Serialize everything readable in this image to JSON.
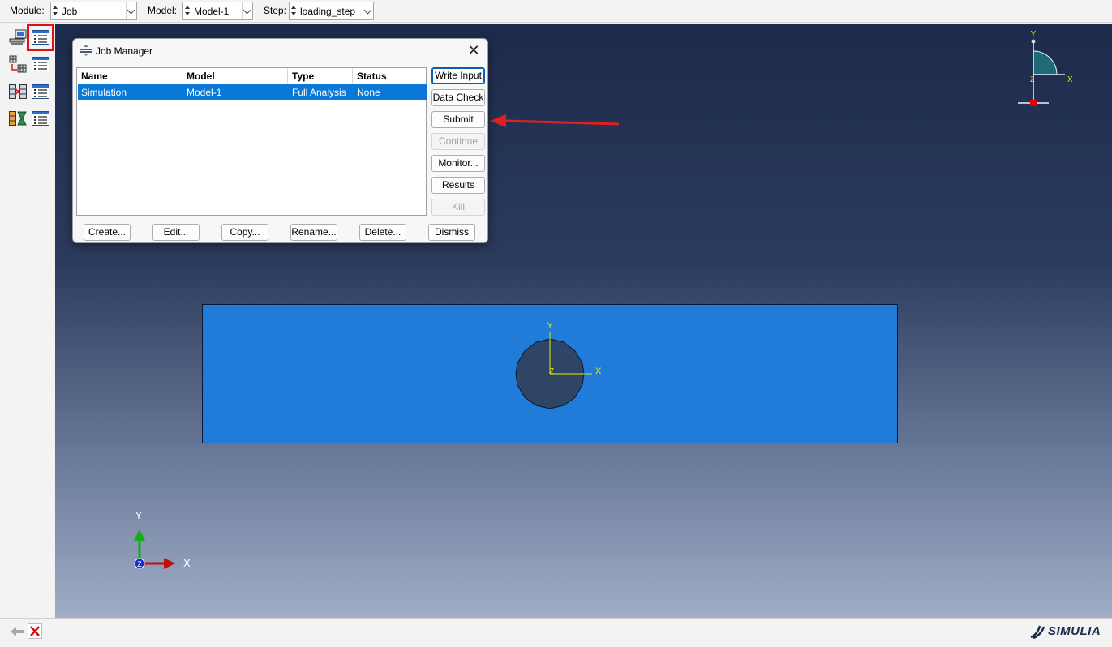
{
  "context_bar": {
    "module_label": "Module:",
    "module_value": "Job",
    "model_label": "Model:",
    "model_value": "Model-1",
    "step_label": "Step:",
    "step_value": "loading_step"
  },
  "toolbox": {
    "tools": [
      {
        "name": "job-create-icon",
        "highlighted": false
      },
      {
        "name": "job-manager-icon",
        "highlighted": true
      },
      {
        "name": "adaptivity-create-icon",
        "highlighted": false
      },
      {
        "name": "adaptivity-manager-icon",
        "highlighted": false
      },
      {
        "name": "coexecution-create-icon",
        "highlighted": false
      },
      {
        "name": "coexecution-manager-icon",
        "highlighted": false
      },
      {
        "name": "optimization-create-icon",
        "highlighted": false
      },
      {
        "name": "optimization-manager-icon",
        "highlighted": false
      }
    ]
  },
  "dialog": {
    "title": "Job Manager",
    "columns": [
      "Name",
      "Model",
      "Type",
      "Status"
    ],
    "rows": [
      {
        "name": "Simulation",
        "model": "Model-1",
        "type": "Full Analysis",
        "status": "None",
        "selected": true
      }
    ],
    "side_buttons": [
      {
        "label": "Write Input",
        "enabled": true
      },
      {
        "label": "Data Check",
        "enabled": true
      },
      {
        "label": "Submit",
        "enabled": true
      },
      {
        "label": "Continue",
        "enabled": false
      },
      {
        "label": "Monitor...",
        "enabled": true
      },
      {
        "label": "Results",
        "enabled": true
      },
      {
        "label": "Kill",
        "enabled": false
      }
    ],
    "bottom_buttons": [
      "Create...",
      "Edit...",
      "Copy...",
      "Rename...",
      "Delete...",
      "Dismiss"
    ]
  },
  "viewport": {
    "part_color": "#207cd8",
    "hole_color": "#2f4566",
    "csys_axis_color": "#e8e800",
    "part_csys": {
      "x_label": "X",
      "y_label": "Y",
      "z_label": "Z"
    },
    "triad": {
      "x_label": "X",
      "y_label": "Y",
      "z_label": "Z"
    },
    "view_cube": {
      "x_label": "X",
      "y_label": "Y",
      "z_label": "Z"
    },
    "annotation_arrow_color": "#e02020"
  },
  "brand": {
    "text": "SIMULIA"
  }
}
